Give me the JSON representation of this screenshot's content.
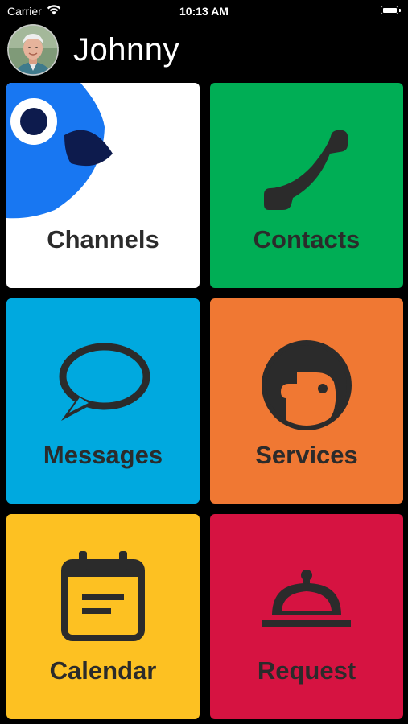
{
  "status_bar": {
    "carrier": "Carrier",
    "time": "10:13 AM",
    "icons": [
      "wifi-icon",
      "battery-icon"
    ]
  },
  "header": {
    "user_name": "Johnny",
    "avatar_icon": "user-avatar"
  },
  "tiles": [
    {
      "label": "Channels",
      "color": "#ffffff",
      "icon": "bird-icon"
    },
    {
      "label": "Contacts",
      "color": "#00ae55",
      "icon": "phone-icon"
    },
    {
      "label": "Messages",
      "color": "#00a9df",
      "icon": "speech-bubble-icon"
    },
    {
      "label": "Services",
      "color": "#f07833",
      "icon": "face-icon"
    },
    {
      "label": "Calendar",
      "color": "#fdc122",
      "icon": "calendar-icon"
    },
    {
      "label": "Request",
      "color": "#d61341",
      "icon": "service-bell-icon"
    }
  ],
  "colors": {
    "background": "#000000",
    "label_text": "#2b2b2b",
    "icon_dark": "#2b2b2b",
    "bird_blue": "#1877f2",
    "bird_dark": "#0d1b4d"
  }
}
